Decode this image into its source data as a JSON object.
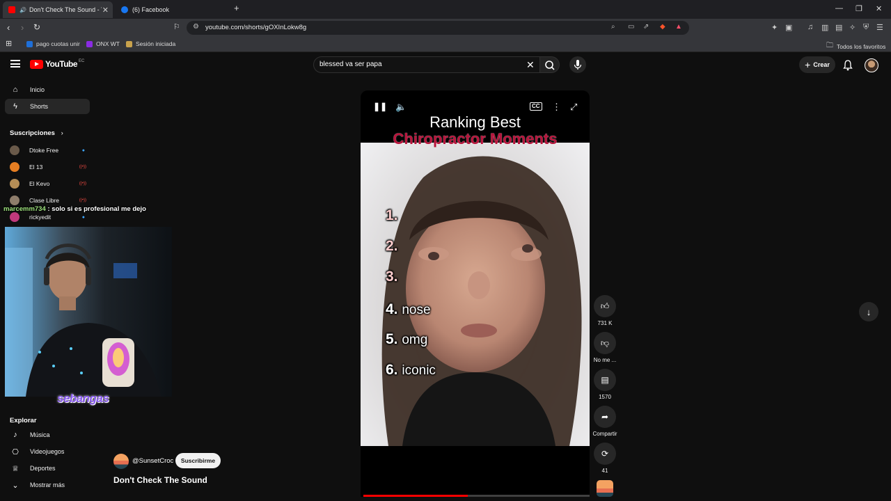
{
  "browser": {
    "tabs": [
      {
        "title": "Don't Check The Sound - You",
        "active": true,
        "favicon_color": "#ff0000"
      },
      {
        "title": "(6) Facebook",
        "active": false,
        "favicon_color": "#1877f2"
      }
    ],
    "new_tab_icon": "plus-icon",
    "url": "youtube.com/shorts/gOXInLokw8g",
    "bookmarks": [
      {
        "label": "pago cuotas unir",
        "icon_color": "#1e6fd9"
      },
      {
        "label": "ONX WT",
        "icon_color": "#8a2be2"
      },
      {
        "label": "Sesión iniciada",
        "icon_color": "#c8a24c"
      }
    ],
    "all_favorites_label": "Todos los favoritos"
  },
  "youtube": {
    "logo_text": "YouTube",
    "logo_region": "EC",
    "search": {
      "value": "blessed va ser papa"
    },
    "create_label": "Crear",
    "sidebar": {
      "main": [
        {
          "label": "Inicio",
          "icon": "home-icon"
        },
        {
          "label": "Shorts",
          "icon": "shorts-icon",
          "active": true
        }
      ],
      "subscriptions_heading": "Suscripciones",
      "subscriptions": [
        {
          "label": "Dtoke Free",
          "avatar_color": "#6a5a4a",
          "status": "dot"
        },
        {
          "label": "El 13",
          "avatar_color": "#e67e22",
          "status": "live"
        },
        {
          "label": "El Kevo",
          "avatar_color": "#b58e56",
          "status": "live"
        },
        {
          "label": "Clase Libre",
          "avatar_color": "#8e7d6b",
          "status": "live"
        },
        {
          "label": "rickyedit",
          "avatar_color": "#c0397b",
          "status": "dot"
        }
      ],
      "explore_heading": "Explorar",
      "explore": [
        {
          "label": "Música",
          "icon": "music-note-icon"
        },
        {
          "label": "Videojuegos",
          "icon": "gamepad-icon"
        },
        {
          "label": "Deportes",
          "icon": "trophy-icon"
        },
        {
          "label": "Mostrar más",
          "icon": "chevron-down-icon"
        }
      ]
    }
  },
  "stream_overlay": {
    "chat_user": "marcemm734",
    "chat_text": " : solo si es profesional me dejo",
    "streamer_name": "sebangas"
  },
  "short": {
    "title_line1": "Ranking Best",
    "title_line2": "Chiropractor Moments",
    "ranks": [
      {
        "num": "1.",
        "word": ""
      },
      {
        "num": "2.",
        "word": ""
      },
      {
        "num": "3.",
        "word": ""
      },
      {
        "num": "4.",
        "word": "nose"
      },
      {
        "num": "5.",
        "word": "omg"
      },
      {
        "num": "6.",
        "word": "iconic"
      }
    ],
    "progress_fraction": 0.46,
    "actions": {
      "likes": "731 K",
      "dislike_label": "No me ...",
      "comments": "1570",
      "share_label": "Compartir",
      "remix_count": "41"
    },
    "channel": "@SunsetCroc",
    "subscribe_label": "Suscribirme",
    "video_title": "Don't Check The Sound"
  }
}
